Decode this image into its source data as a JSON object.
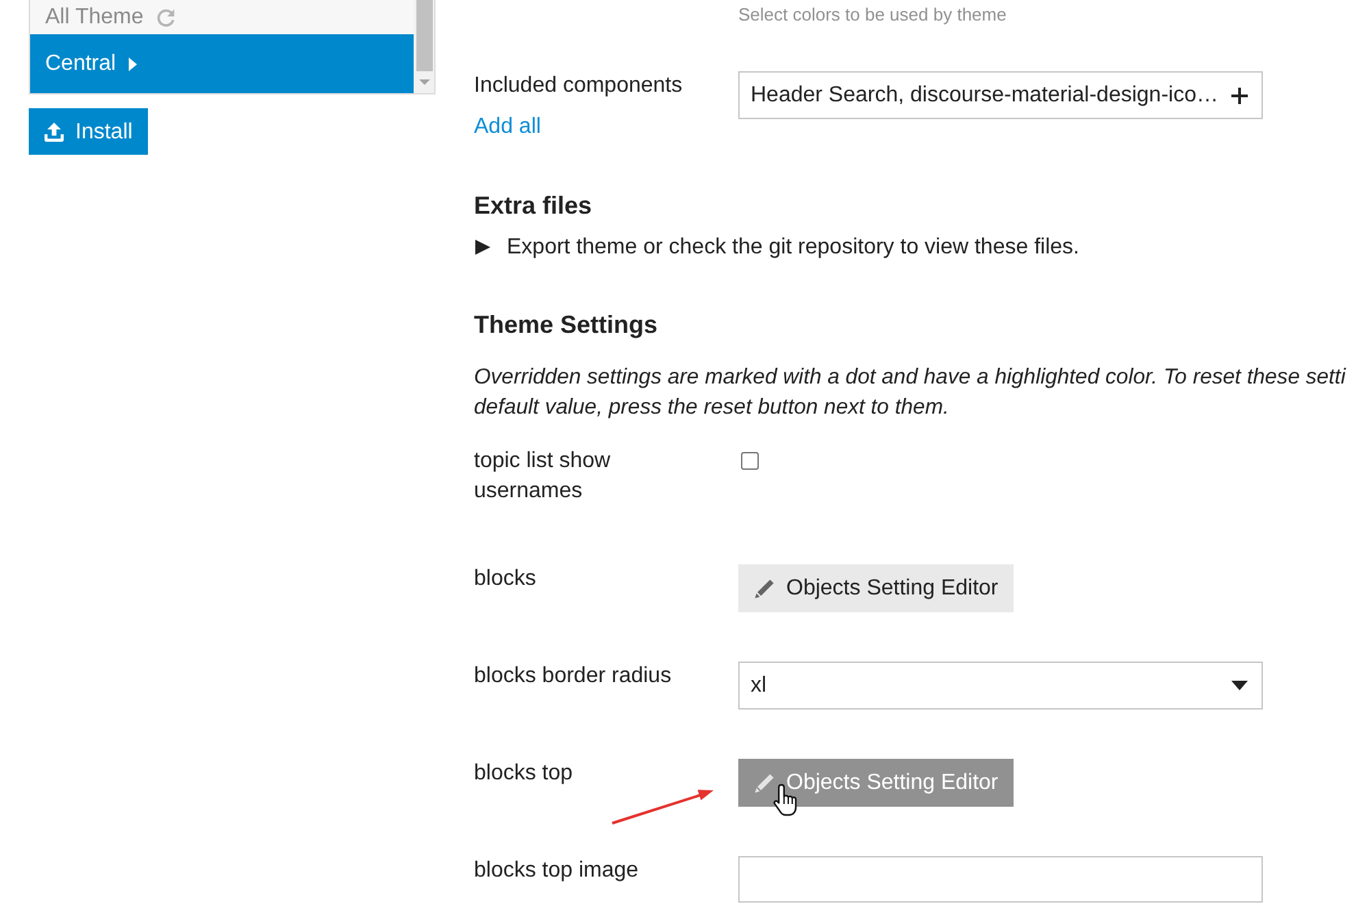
{
  "sidebar": {
    "items": [
      {
        "label": "All Theme",
        "selected": false,
        "update_available": true
      },
      {
        "label": "Central",
        "selected": true,
        "update_available": false
      }
    ],
    "install_button": "Install"
  },
  "color_scheme_hint": "Select colors to be used by theme",
  "components": {
    "label": "Included components",
    "value": "Header Search, discourse-material-design-ico…",
    "add_all": "Add all"
  },
  "extra_files": {
    "heading": "Extra files",
    "expanded": false,
    "summary": "Export theme or check the git repository to view these files."
  },
  "theme_settings": {
    "heading": "Theme Settings",
    "note_lines": [
      "Overridden settings are marked with a dot and have a highlighted color. To reset these setti",
      "default value, press the reset button next to them."
    ],
    "settings": [
      {
        "kind": "checkbox",
        "label": "topic list show usernames",
        "checked": false,
        "annotated": false
      },
      {
        "kind": "button",
        "label": "blocks",
        "button": "Objects Setting Editor",
        "hovered": false,
        "annotated": false
      },
      {
        "kind": "select",
        "label": "blocks border radius",
        "value": "xl",
        "annotated": false
      },
      {
        "kind": "button",
        "label": "blocks top",
        "button": "Objects Setting Editor",
        "hovered": true,
        "annotated": true
      },
      {
        "kind": "text",
        "label": "blocks top image",
        "annotated": false
      }
    ]
  }
}
